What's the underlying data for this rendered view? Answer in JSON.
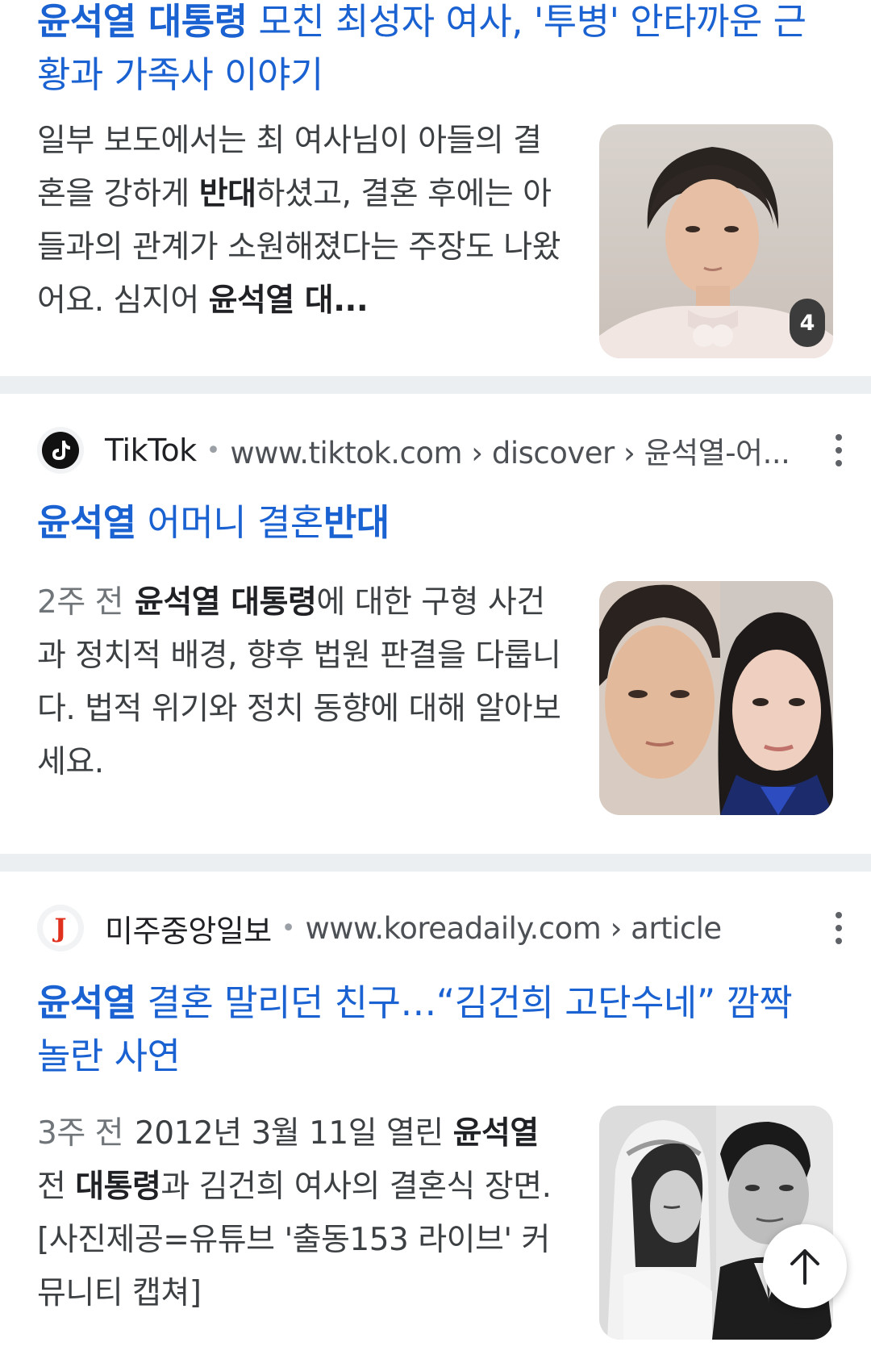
{
  "results": [
    {
      "title_prefix_bold": "윤석열 대통령",
      "title_rest": " 모친 최성자 여사, '투병' 안타까운 근황과 가족사 이야기",
      "snippet_parts": [
        {
          "t": "일부 보도에서는 최 여사님이 아들의 결혼을 강하게 "
        },
        {
          "t": "반대",
          "b": true
        },
        {
          "t": "하셨고, 결혼 후에는 아들과의 관계가 소원해졌다는 주장도 나왔어요. 심지어 "
        },
        {
          "t": "윤석열 대",
          "b": true
        }
      ],
      "snippet_ellipsis": "...",
      "image_count_badge": "4"
    },
    {
      "site_name": "TikTok",
      "url": "www.tiktok.com › discover › 윤석열-어...",
      "title_parts": [
        {
          "t": "윤석열",
          "b": true
        },
        {
          "t": " 어머니 결혼"
        },
        {
          "t": "반대",
          "b": true
        }
      ],
      "age": "2주 전",
      "snippet_parts": [
        {
          "t": "윤석열 대통령",
          "b": true
        },
        {
          "t": "에 대한 구형 사건과 정치적 배경, 향후 법원 판결을 다룹니다. 법적 위기와 정치 동향에 대해 알아보세요."
        }
      ]
    },
    {
      "site_name": "미주중앙일보",
      "favicon_letter": "J",
      "url": "www.koreadaily.com › article",
      "title_parts": [
        {
          "t": "윤석열",
          "b": true
        },
        {
          "t": " 결혼 말리던 친구…“김건희 고단수네” 깜짝 놀란 사연"
        }
      ],
      "age": "3주 전",
      "snippet_parts": [
        {
          "t": "2012년 3월 11일 열린 "
        },
        {
          "t": "윤석열",
          "b": true
        },
        {
          "t": " 전 "
        },
        {
          "t": "대통령",
          "b": true
        },
        {
          "t": "과 김건희 여사의 결혼식 장면. [사진제공=유튜브 '출동153 라이브' 커뮤니티 캡쳐]"
        }
      ]
    }
  ],
  "colors": {
    "title_link": "#1a61d1",
    "divider": "#eceff1",
    "text": "#3c4043"
  },
  "icons": [
    "tiktok-logo-icon",
    "koreadaily-logo-icon",
    "more-vert-icon",
    "arrow-up-icon"
  ]
}
